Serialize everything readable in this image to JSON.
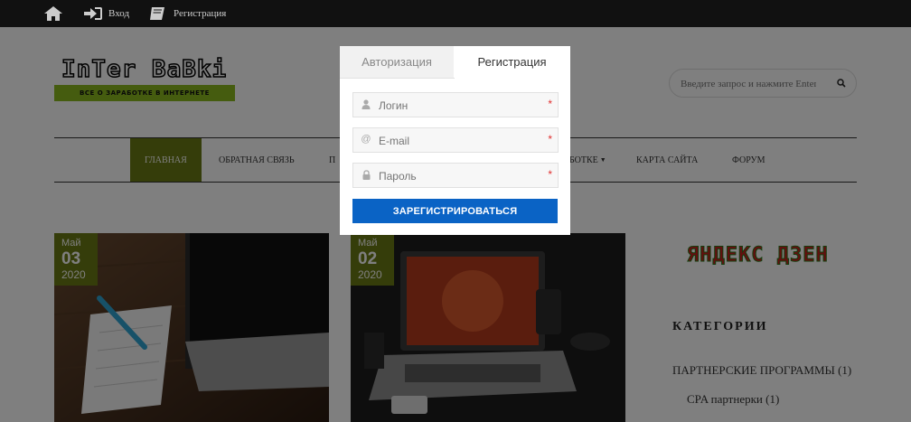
{
  "topbar": {
    "login_label": "Вход",
    "register_label": "Регистрация",
    "icons": [
      "home-icon",
      "sign-in-icon",
      "book-icon"
    ]
  },
  "logo": {
    "text": "InTer BaBki",
    "tagline": "ВСЕ О ЗАРАБОТКЕ В ИНТЕРНЕТЕ"
  },
  "search": {
    "placeholder": "Введите запрос и нажмите Enter"
  },
  "nav": {
    "items": [
      {
        "label": "Главная"
      },
      {
        "label": "Обратная связь"
      },
      {
        "label": "П"
      },
      {
        "label": "ботке"
      },
      {
        "label": "Карта сайта"
      },
      {
        "label": "Форум"
      }
    ]
  },
  "posts": [
    {
      "month": "Май",
      "day": "03",
      "year": "2020"
    },
    {
      "month": "Май",
      "day": "02",
      "year": "2020"
    }
  ],
  "sidebar": {
    "zen_banner": "ЯНДЕКС ДЗЕН",
    "categories_title": "КАТЕГОРИИ",
    "categories": [
      {
        "label": "ПАРТНЕРСКИЕ ПРОГРАММЫ",
        "count": "(1)"
      },
      {
        "label": "CPA партнерки",
        "count": "(1)"
      }
    ]
  },
  "modal": {
    "tab_login": "Авторизация",
    "tab_register": "Регистрация",
    "fields": {
      "login_placeholder": "Логин",
      "email_placeholder": "E-mail",
      "password_placeholder": "Пароль"
    },
    "required_mark": "*",
    "submit_label": "ЗАРЕГИСТРИРОВАТЬСЯ"
  }
}
